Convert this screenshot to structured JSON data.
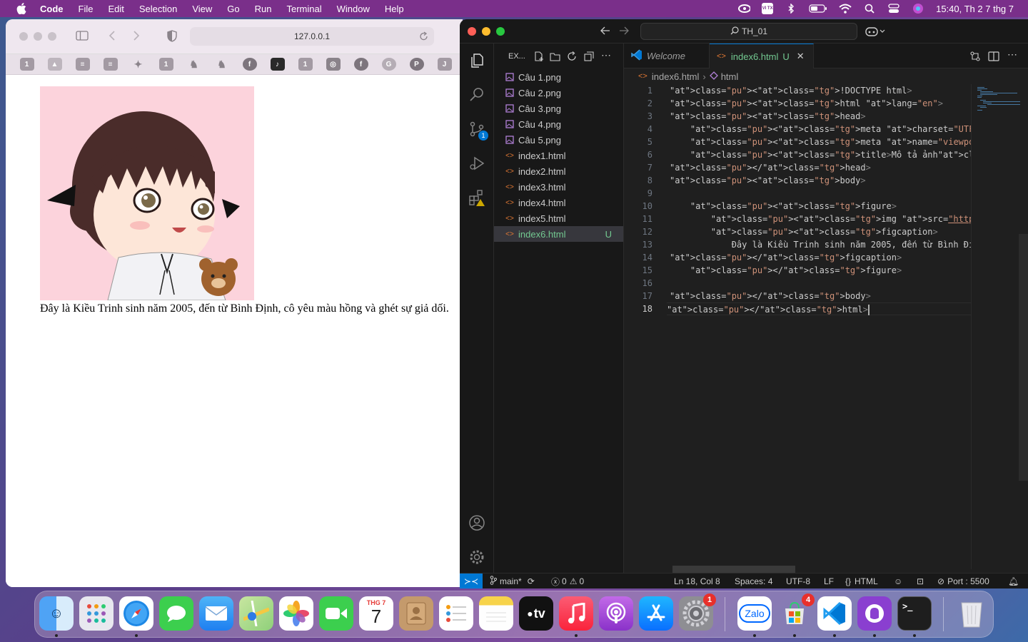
{
  "menubar": {
    "app_name": "Code",
    "items": [
      "File",
      "Edit",
      "Selection",
      "View",
      "Go",
      "Run",
      "Terminal",
      "Window",
      "Help"
    ],
    "keyboard_indicator": "VI TX",
    "clock": "15:40, Th 2 7 thg 7"
  },
  "safari": {
    "url": "127.0.0.1",
    "favorites": [
      "1",
      "",
      "",
      "",
      "",
      "1",
      "",
      "",
      "",
      "",
      "1",
      "",
      "",
      "",
      "",
      "J"
    ],
    "caption": "Đây là Kiều Trinh sinh năm 2005, đến từ Bình Định, cô yêu màu hồng và ghét sự giả dối."
  },
  "vscode": {
    "search": "TH_01",
    "explorer_title": "EX...",
    "files": [
      {
        "name": "Câu 1.png",
        "type": "png"
      },
      {
        "name": "Câu 2.png",
        "type": "png"
      },
      {
        "name": "Câu 3.png",
        "type": "png"
      },
      {
        "name": "Câu 4.png",
        "type": "png"
      },
      {
        "name": "Câu 5.png",
        "type": "png"
      },
      {
        "name": "index1.html",
        "type": "html"
      },
      {
        "name": "index2.html",
        "type": "html"
      },
      {
        "name": "index3.html",
        "type": "html"
      },
      {
        "name": "index4.html",
        "type": "html"
      },
      {
        "name": "index5.html",
        "type": "html"
      },
      {
        "name": "index6.html",
        "type": "html",
        "badge": "U",
        "selected": true
      }
    ],
    "source_control_badge": "1",
    "tabs": [
      {
        "label": "Welcome"
      },
      {
        "label": "index6.html",
        "badge": "U"
      }
    ],
    "breadcrumb": [
      "index6.html",
      "html"
    ],
    "line_numbers": [
      "1",
      "2",
      "3",
      "4",
      "5",
      "6",
      "7",
      "8",
      "9",
      "10",
      "11",
      "12",
      "13",
      "14",
      "15",
      "16",
      "17",
      "18"
    ],
    "code_lines": [
      "<!DOCTYPE html>",
      "<html lang=\"en\">",
      "<head>",
      "    <meta charset=\"UTF-8\">",
      "    <meta name=\"viewport\" content=\"width=device-width, init",
      "    <title>Mô tả ảnh</title>",
      "</head>",
      "<body>",
      "",
      "    <figure>",
      "        <img src=\"https://idep.edu.vn/upload/2025/02/hinh-a",
      "        <figcaption>",
      "            Đây là Kiều Trinh sinh năm 2005, đến từ Bình Đị",
      "</figcaption>",
      "    </figure>",
      "",
      "</body>",
      "</html>"
    ],
    "status": {
      "branch": "main*",
      "errors": "0",
      "warnings": "0",
      "position": "Ln 18, Col 8",
      "spaces": "Spaces: 4",
      "encoding": "UTF-8",
      "eol": "LF",
      "language": "HTML",
      "port": "Port : 5500"
    }
  },
  "dock": {
    "calendar_month": "THG 7",
    "calendar_day": "7",
    "tv_label": "tv",
    "zalo_label": "Zalo",
    "settings_badge": "1",
    "store_badge": "4"
  },
  "colors": {
    "menubar": "#7a2f8a",
    "vscode_bg": "#1f1f1f",
    "accent_blue": "#0078d4",
    "untracked_green": "#73c991",
    "avatar_bg": "#fcd3dc"
  }
}
